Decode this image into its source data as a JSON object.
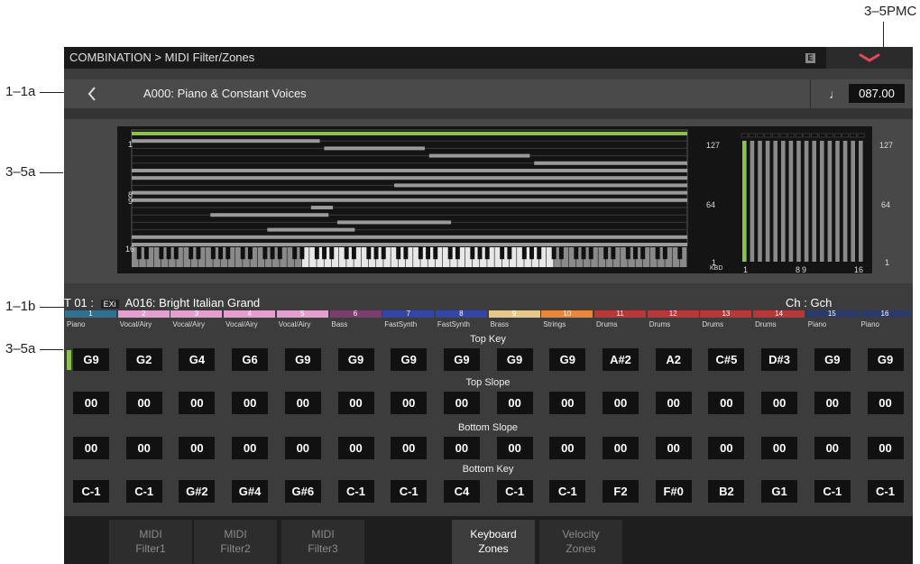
{
  "callouts": {
    "top_right": "3–5PMC",
    "label_1a": "1–1a",
    "label_3a_top": "3–5a",
    "label_1b": "1–1b",
    "label_3a_bottom": "3–5a"
  },
  "topbar": {
    "breadcrumb": "COMBINATION > MIDI Filter/Zones",
    "badge": "E"
  },
  "header": {
    "combi_name": "A000: Piano & Constant Voices",
    "tempo": "087.00"
  },
  "graph": {
    "track_axis": [
      "1",
      "8",
      "9",
      "16"
    ],
    "note_axis": [
      "127",
      "64",
      "1"
    ],
    "kbd_label": "KBD",
    "vel_axis": [
      "127",
      "64",
      "1"
    ],
    "vel_track_axis": [
      "1",
      "8",
      "9",
      "16"
    ]
  },
  "timbre": {
    "label": "T 01 :",
    "exi": "EXi",
    "program": "A016: Bright Italian Grand",
    "channel": "Ch : Gch"
  },
  "sections": {
    "top_key": "Top Key",
    "top_slope": "Top Slope",
    "bottom_slope": "Bottom Slope",
    "bottom_key": "Bottom Key"
  },
  "tracks": [
    {
      "num": "1",
      "name": "Piano",
      "color": "#2f6f8f",
      "top_key": "G9",
      "top_slope": "00",
      "bottom_slope": "00",
      "bottom_key": "C-1"
    },
    {
      "num": "2",
      "name": "Vocal/Airy",
      "color": "#e49fcf",
      "top_key": "G2",
      "top_slope": "00",
      "bottom_slope": "00",
      "bottom_key": "C-1"
    },
    {
      "num": "3",
      "name": "Vocal/Airy",
      "color": "#e49fcf",
      "top_key": "G4",
      "top_slope": "00",
      "bottom_slope": "00",
      "bottom_key": "G#2"
    },
    {
      "num": "4",
      "name": "Vocal/Airy",
      "color": "#e49fcf",
      "top_key": "G6",
      "top_slope": "00",
      "bottom_slope": "00",
      "bottom_key": "G#4"
    },
    {
      "num": "5",
      "name": "Vocal/Airy",
      "color": "#e49fcf",
      "top_key": "G9",
      "top_slope": "00",
      "bottom_slope": "00",
      "bottom_key": "G#6"
    },
    {
      "num": "6",
      "name": "Bass",
      "color": "#7a3d6e",
      "top_key": "G9",
      "top_slope": "00",
      "bottom_slope": "00",
      "bottom_key": "C-1"
    },
    {
      "num": "7",
      "name": "FastSynth",
      "color": "#3346a6",
      "top_key": "G9",
      "top_slope": "00",
      "bottom_slope": "00",
      "bottom_key": "C-1"
    },
    {
      "num": "8",
      "name": "FastSynth",
      "color": "#3346a6",
      "top_key": "G9",
      "top_slope": "00",
      "bottom_slope": "00",
      "bottom_key": "C4"
    },
    {
      "num": "9",
      "name": "Brass",
      "color": "#e6c98a",
      "top_key": "G9",
      "top_slope": "00",
      "bottom_slope": "00",
      "bottom_key": "C-1"
    },
    {
      "num": "10",
      "name": "Strings",
      "color": "#e8863a",
      "top_key": "G9",
      "top_slope": "00",
      "bottom_slope": "00",
      "bottom_key": "C-1"
    },
    {
      "num": "11",
      "name": "Drums",
      "color": "#b8383a",
      "top_key": "A#2",
      "top_slope": "00",
      "bottom_slope": "00",
      "bottom_key": "F2"
    },
    {
      "num": "12",
      "name": "Drums",
      "color": "#b8383a",
      "top_key": "A2",
      "top_slope": "00",
      "bottom_slope": "00",
      "bottom_key": "F#0"
    },
    {
      "num": "13",
      "name": "Drums",
      "color": "#b8383a",
      "top_key": "C#5",
      "top_slope": "00",
      "bottom_slope": "00",
      "bottom_key": "B2"
    },
    {
      "num": "14",
      "name": "Drums",
      "color": "#b8383a",
      "top_key": "D#3",
      "top_slope": "00",
      "bottom_slope": "00",
      "bottom_key": "G1"
    },
    {
      "num": "15",
      "name": "Piano",
      "color": "#2b3a66",
      "top_key": "G9",
      "top_slope": "00",
      "bottom_slope": "00",
      "bottom_key": "C-1"
    },
    {
      "num": "16",
      "name": "Piano",
      "color": "#2b3a66",
      "top_key": "G9",
      "top_slope": "00",
      "bottom_slope": "00",
      "bottom_key": "C-1"
    }
  ],
  "tabs": [
    {
      "l1": "MIDI",
      "l2": "Filter1"
    },
    {
      "l1": "MIDI",
      "l2": "Filter2"
    },
    {
      "l1": "MIDI",
      "l2": "Filter3"
    },
    {
      "l1": "Keyboard",
      "l2": "Zones"
    },
    {
      "l1": "Velocity",
      "l2": "Zones"
    }
  ],
  "colors": {
    "accent_green": "#8bc34a",
    "chevron": "#e8485a",
    "zone_bar": "#9a9a9a"
  }
}
